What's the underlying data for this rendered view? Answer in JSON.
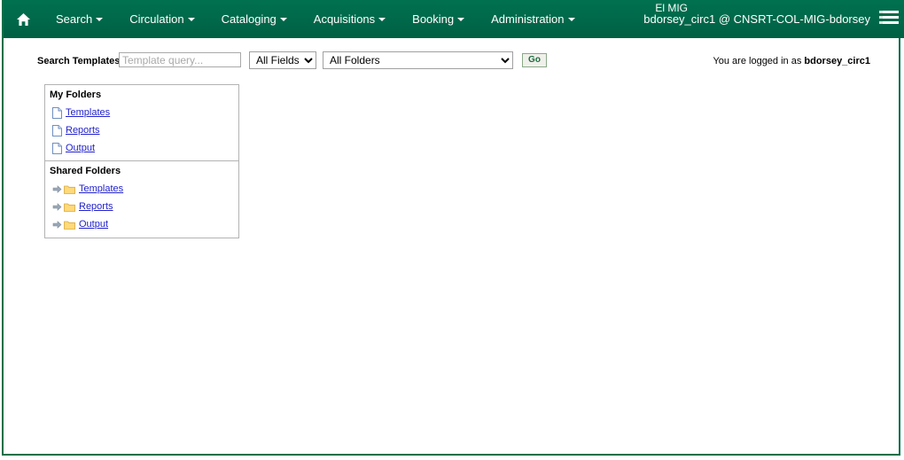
{
  "navbar": {
    "home_icon": "home-icon",
    "menu_icon": "hamburger-menu-icon",
    "items": [
      {
        "label": "Search",
        "has_caret": true
      },
      {
        "label": "Circulation",
        "has_caret": true
      },
      {
        "label": "Cataloging",
        "has_caret": true
      },
      {
        "label": "Acquisitions",
        "has_caret": true
      },
      {
        "label": "Booking",
        "has_caret": true
      },
      {
        "label": "Administration",
        "has_caret": true
      }
    ],
    "org_label": "El MIG",
    "user_label": "bdorsey_circ1 @ CNSRT-COL-MIG-bdorsey"
  },
  "search": {
    "label": "Search Templates",
    "query_value": "",
    "query_placeholder": "Template query...",
    "field_selected": "All Fields",
    "field_options": [
      "All Fields"
    ],
    "folder_selected": "All Folders",
    "folder_options": [
      "All Folders"
    ],
    "go_label": "Go",
    "login_status_prefix": "You are logged in as ",
    "login_status_user": "bdorsey_circ1"
  },
  "my_folders": {
    "title": "My Folders",
    "items": [
      {
        "label": "Templates",
        "icon": "page-icon"
      },
      {
        "label": "Reports",
        "icon": "page-icon"
      },
      {
        "label": "Output",
        "icon": "page-icon"
      }
    ]
  },
  "shared_folders": {
    "title": "Shared Folders",
    "items": [
      {
        "label": "Templates",
        "icon": "folder-icon",
        "expander": "arrow-right-icon"
      },
      {
        "label": "Reports",
        "icon": "folder-icon",
        "expander": "arrow-right-icon"
      },
      {
        "label": "Output",
        "icon": "folder-icon",
        "expander": "arrow-right-icon"
      }
    ]
  },
  "colors": {
    "header_green": "#00684a",
    "frame_border": "#00704a",
    "link_blue": "#2222cc",
    "folder_yellow": "#ffd97a",
    "go_text": "#1d6b3f"
  }
}
